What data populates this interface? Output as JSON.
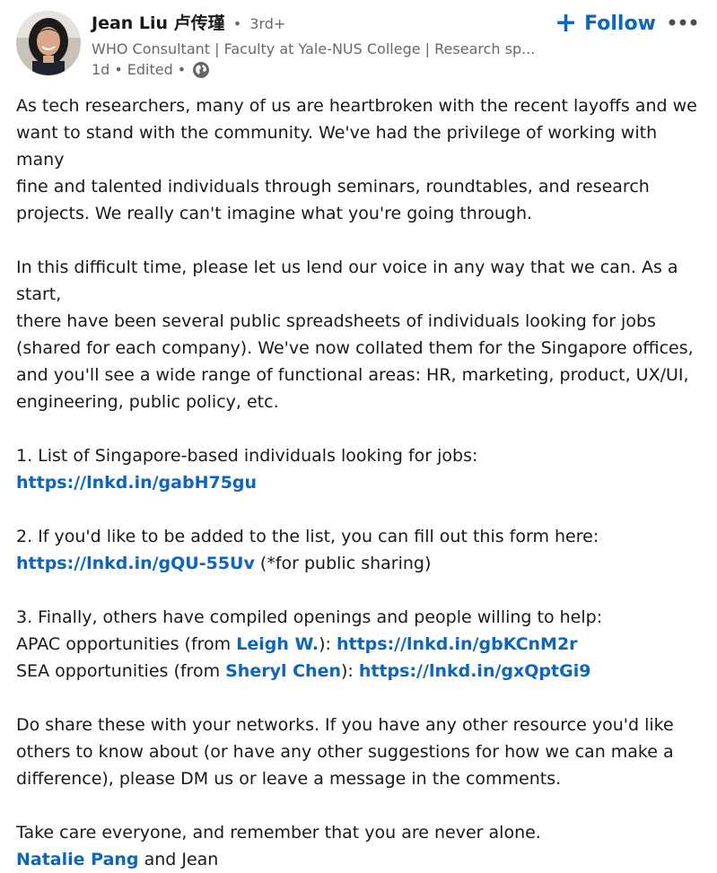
{
  "post": {
    "author": {
      "name": "Jean Liu 卢传瑾",
      "separator": "•",
      "degree": "3rd+",
      "headline": "WHO Consultant | Faculty at Yale-NUS College | Research sp...",
      "time": "1d",
      "edited": "Edited",
      "visibility_icon": "globe-icon"
    },
    "follow_label": "Follow",
    "follow_icon": "plus-icon",
    "more_icon": "more-dots-icon",
    "paragraph1": [
      "As tech researchers, many of us are heartbroken with the recent layoffs and we",
      "want to stand with the community. We've had the privilege of working with many",
      "fine and talented individuals through seminars, roundtables, and research",
      "projects. We really can't imagine what you're going through."
    ],
    "paragraph2": [
      "In this difficult time, please let us lend our voice in any way that we can. As a start,",
      "there have been several public spreadsheets of individuals looking for jobs",
      "(shared for each company). We've now collated them for the Singapore offices,",
      "and you'll see a wide range of functional areas: HR, marketing, product, UX/UI,",
      "engineering, public policy, etc."
    ],
    "item1": {
      "text": "1. List of Singapore-based individuals looking for jobs: ",
      "link": "https://lnkd.in/gabH75gu"
    },
    "item2": {
      "text": "2. If you'd like to be added to the list, you can fill out this form here:",
      "link": "https://lnkd.in/gQU-55Uv",
      "suffix": " (*for public sharing)"
    },
    "item3": {
      "intro": "3. Finally, others have compiled openings and people willing to help:",
      "apac_prefix": "APAC opportunities (from ",
      "apac_mention": "Leigh W.",
      "apac_mid": "): ",
      "apac_link": "https://lnkd.in/gbKCnM2r",
      "sea_prefix": "SEA opportunities (from ",
      "sea_mention": "Sheryl Chen",
      "sea_mid": "): ",
      "sea_link": "https://lnkd.in/gxQptGi9"
    },
    "paragraph3": [
      "Do share these with your networks. If you have any other resource you'd like",
      "others to know about (or have any other suggestions for how we can make a",
      "difference), please DM us or leave a message in the comments."
    ],
    "closing": {
      "line": "Take care everyone, and remember that you are never alone.",
      "mention": "Natalie Pang",
      "suffix": " and Jean"
    }
  },
  "colors": {
    "link": "#0a66c2",
    "muted": "rgba(0,0,0,0.6)",
    "text": "rgba(0,0,0,0.9)"
  }
}
